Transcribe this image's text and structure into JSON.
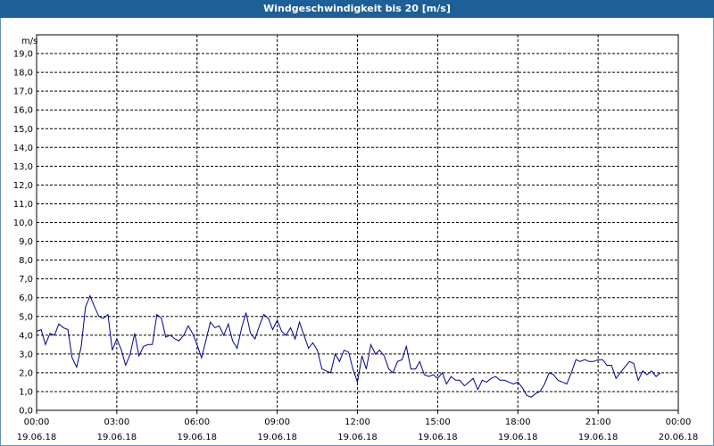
{
  "title": "Windgeschwindigkeit bis 20 [m/s]",
  "colors": {
    "titlebar": "#1d5f96",
    "line": "#00008b",
    "grid": "#000000"
  },
  "chart_data": {
    "type": "line",
    "title": "Windgeschwindigkeit bis 20 [m/s]",
    "ylabel": "m/s",
    "ylim": [
      0,
      20
    ],
    "yticks": [
      "0,0",
      "1,0",
      "2,0",
      "3,0",
      "4,0",
      "5,0",
      "6,0",
      "7,0",
      "8,0",
      "9,0",
      "10,0",
      "11,0",
      "12,0",
      "13,0",
      "14,0",
      "15,0",
      "16,0",
      "17,0",
      "18,0",
      "19,0"
    ],
    "xticks": [
      {
        "time": "00:00",
        "date": "19.06.18"
      },
      {
        "time": "03:00",
        "date": "19.06.18"
      },
      {
        "time": "06:00",
        "date": "19.06.18"
      },
      {
        "time": "09:00",
        "date": "19.06.18"
      },
      {
        "time": "12:00",
        "date": "19.06.18"
      },
      {
        "time": "15:00",
        "date": "19.06.18"
      },
      {
        "time": "18:00",
        "date": "19.06.18"
      },
      {
        "time": "21:00",
        "date": "19.06.18"
      },
      {
        "time": "00:00",
        "date": "20.06.18"
      }
    ],
    "grid": true,
    "series": [
      {
        "x_hours": [
          0,
          0.17,
          0.33,
          0.5,
          0.67,
          0.83,
          1,
          1.17,
          1.33,
          1.5,
          1.67,
          1.83,
          2,
          2.17,
          2.33,
          2.5,
          2.67,
          2.83,
          3,
          3.17,
          3.33,
          3.5,
          3.67,
          3.83,
          4,
          4.17,
          4.33,
          4.5,
          4.67,
          4.83,
          5,
          5.17,
          5.33,
          5.5,
          5.67,
          5.83,
          6,
          6.17,
          6.33,
          6.5,
          6.67,
          6.83,
          7,
          7.17,
          7.33,
          7.5,
          7.67,
          7.83,
          8,
          8.17,
          8.33,
          8.5,
          8.67,
          8.83,
          9,
          9.17,
          9.33,
          9.5,
          9.67,
          9.83,
          10,
          10.17,
          10.33,
          10.5,
          10.67,
          10.83,
          11,
          11.17,
          11.33,
          11.5,
          11.67,
          11.83,
          12,
          12.17,
          12.33,
          12.5,
          12.67,
          12.83,
          13,
          13.17,
          13.33,
          13.5,
          13.67,
          13.83,
          14,
          14.17,
          14.33,
          14.5,
          14.67,
          14.83,
          15,
          15.17,
          15.33,
          15.5,
          15.67,
          15.83,
          16,
          16.17,
          16.33,
          16.5,
          16.67,
          16.83,
          17,
          17.17,
          17.33,
          17.5,
          17.67,
          17.83,
          18,
          18.17,
          18.33,
          18.5,
          18.67,
          18.83,
          19,
          19.17,
          19.33,
          19.5,
          19.67,
          19.83,
          20,
          20.17,
          20.33,
          20.5,
          20.67,
          20.83,
          21,
          21.17,
          21.33,
          21.5,
          21.67,
          21.83,
          22,
          22.17,
          22.33,
          22.5,
          22.67,
          22.83,
          23,
          23.17,
          23.33,
          23.5,
          23.67,
          23.83,
          24
        ],
        "values": [
          4.2,
          4.3,
          3.5,
          4.1,
          4.0,
          4.6,
          4.4,
          4.3,
          2.8,
          2.3,
          3.4,
          5.5,
          6.1,
          5.5,
          5.0,
          4.9,
          5.1,
          3.2,
          3.8,
          3.2,
          2.4,
          3.0,
          4.1,
          2.9,
          3.4,
          3.5,
          3.5,
          5.1,
          4.9,
          3.9,
          4.0,
          3.8,
          3.7,
          4.0,
          4.5,
          4.1,
          3.5,
          2.8,
          3.7,
          4.7,
          4.4,
          4.5,
          4.0,
          4.6,
          3.7,
          3.3,
          4.4,
          5.2,
          4.1,
          3.8,
          4.5,
          5.1,
          4.9,
          4.3,
          4.8,
          4.2,
          4.0,
          4.4,
          3.8,
          4.7,
          4.0,
          3.3,
          3.6,
          3.2,
          2.2,
          2.1,
          2.0,
          3.0,
          2.6,
          3.2,
          3.1,
          2.2,
          1.5,
          2.9,
          2.2,
          3.5,
          3.0,
          3.2,
          2.9,
          2.2,
          2.0,
          2.6,
          2.7,
          3.4,
          2.2,
          2.2,
          2.6,
          1.9,
          1.8,
          1.9,
          1.7,
          2.0,
          1.4,
          1.8,
          1.6,
          1.6,
          1.3,
          1.5,
          1.7,
          1.1,
          1.6,
          1.5,
          1.7,
          1.8,
          1.6,
          1.6,
          1.5,
          1.4,
          1.5,
          1.2,
          0.8,
          0.7,
          0.9,
          1.0,
          1.4,
          2.0,
          1.9,
          1.6,
          1.5,
          1.4,
          2.0,
          2.7,
          2.6,
          2.7,
          2.6,
          2.6,
          2.7,
          2.7,
          2.4,
          2.4,
          1.7,
          2.0,
          2.3,
          2.6,
          2.5,
          1.6,
          2.1,
          1.9,
          2.1,
          1.8,
          2.0
        ]
      }
    ]
  }
}
